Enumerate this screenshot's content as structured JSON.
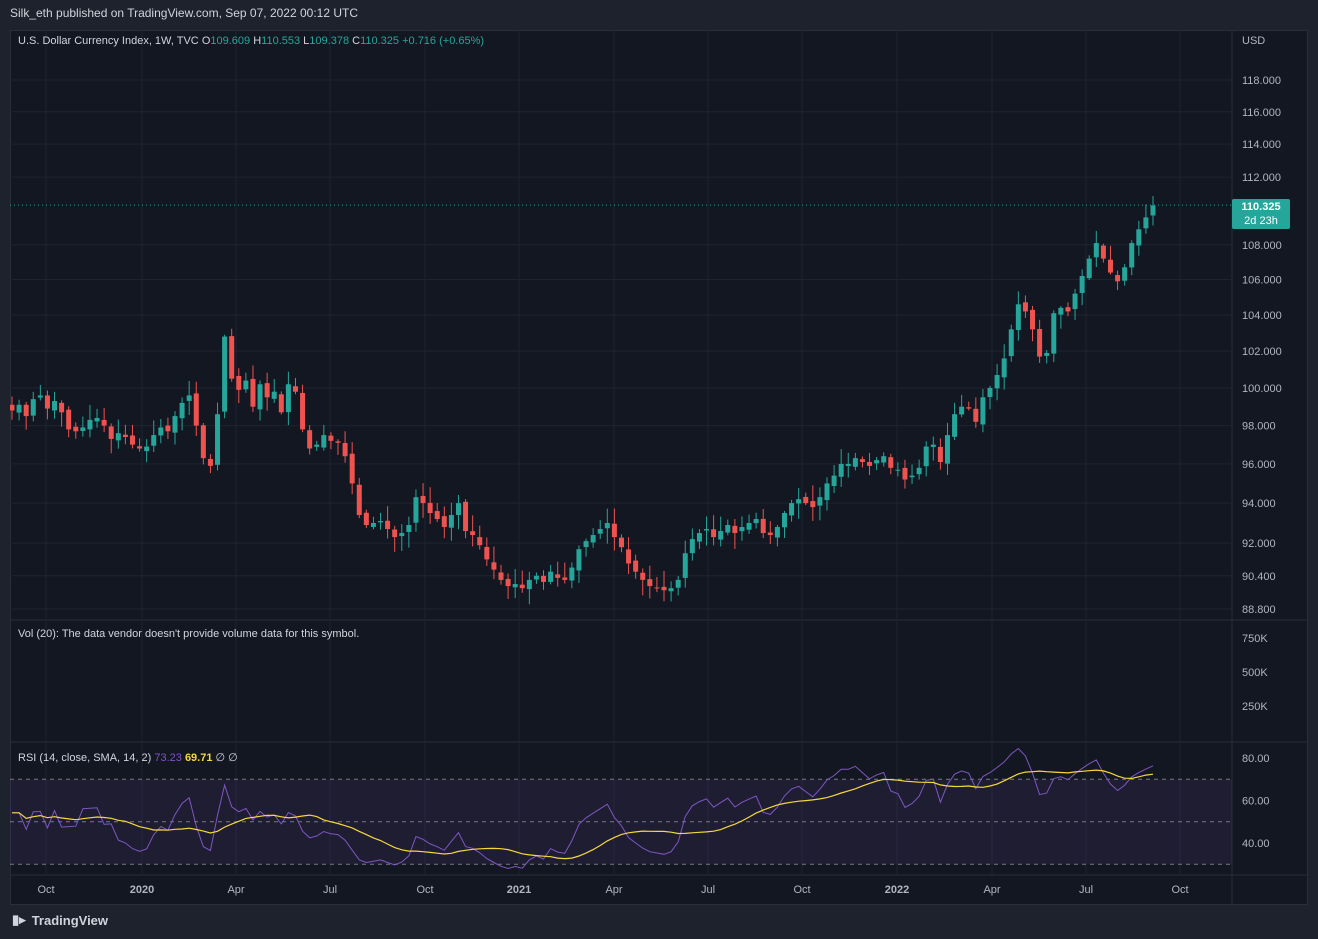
{
  "header": {
    "publisher_line": "Silk_eth published on TradingView.com, Sep 07, 2022 00:12 UTC"
  },
  "legend": {
    "symbol": "U.S. Dollar Currency Index, 1W, TVC",
    "o_label": "O",
    "o": "109.609",
    "h_label": "H",
    "h": "110.553",
    "l_label": "L",
    "l": "109.378",
    "c_label": "C",
    "c": "110.325",
    "change": "+0.716 (+0.65%)"
  },
  "price_axis": {
    "currency": "USD",
    "ticks": [
      "118.000",
      "116.000",
      "114.000",
      "112.000",
      "108.000",
      "106.000",
      "104.000",
      "102.000",
      "100.000",
      "98.000",
      "96.000",
      "94.000",
      "92.000",
      "90.400",
      "88.800"
    ],
    "last_price": "110.325",
    "countdown": "2d 23h"
  },
  "volume": {
    "legend": "Vol (20): The data vendor doesn't provide volume data for this symbol.",
    "ticks": [
      "750K",
      "500K",
      "250K"
    ]
  },
  "rsi": {
    "legend_label": "RSI (14, close, SMA, 14, 2)",
    "rsi_value": "73.23",
    "sma_value": "69.71",
    "extra": "∅ ∅",
    "ticks": [
      "80.00",
      "60.00",
      "40.00"
    ]
  },
  "time_axis": {
    "labels": [
      "Oct",
      "2020",
      "Apr",
      "Jul",
      "Oct",
      "2021",
      "Apr",
      "Jul",
      "Oct",
      "2022",
      "Apr",
      "Jul",
      "Oct"
    ]
  },
  "footer": {
    "brand": "TradingView"
  },
  "colors": {
    "up": "#26a69a",
    "down": "#ef5350",
    "rsi": "#7e57c2",
    "rsi_sma": "#f7d83b",
    "background": "#131722"
  },
  "chart_data": {
    "type": "candlestick",
    "title": "U.S. Dollar Currency Index, 1W, TVC",
    "ylim": [
      88.2,
      119.2
    ],
    "candles_weekly_close": [
      98.8,
      99.1,
      98.5,
      99.4,
      99.6,
      98.9,
      99.3,
      98.7,
      97.8,
      97.7,
      97.9,
      98.3,
      98.4,
      98.0,
      97.3,
      97.6,
      97.4,
      97.0,
      96.8,
      96.9,
      97.5,
      97.9,
      97.7,
      98.5,
      99.2,
      99.6,
      98.0,
      96.3,
      95.9,
      98.6,
      102.8,
      100.5,
      99.9,
      100.4,
      99.0,
      100.2,
      99.5,
      99.8,
      98.7,
      100.2,
      99.8,
      97.8,
      96.8,
      97.0,
      97.5,
      97.2,
      97.1,
      96.4,
      95.0,
      93.4,
      92.9,
      93.0,
      93.1,
      92.7,
      92.3,
      92.5,
      92.9,
      94.3,
      94.0,
      93.5,
      93.2,
      92.8,
      93.4,
      94.0,
      92.6,
      92.4,
      91.9,
      91.2,
      90.7,
      90.2,
      89.9,
      90.0,
      89.8,
      90.2,
      90.4,
      90.1,
      90.6,
      90.3,
      90.2,
      90.8,
      91.7,
      92.1,
      92.4,
      92.7,
      93.0,
      92.3,
      91.8,
      91.0,
      90.6,
      90.2,
      89.9,
      89.8,
      89.7,
      89.8,
      90.2,
      91.5,
      92.2,
      92.5,
      92.7,
      92.3,
      92.6,
      92.9,
      92.5,
      92.8,
      93.0,
      93.2,
      92.5,
      92.4,
      92.8,
      93.5,
      94.0,
      94.2,
      94.0,
      93.8,
      94.3,
      95.0,
      95.4,
      96.0,
      96.0,
      96.3,
      96.1,
      95.9,
      96.2,
      96.4,
      95.8,
      95.7,
      95.2,
      95.4,
      95.8,
      96.9,
      97.0,
      96.1,
      97.5,
      98.6,
      99.0,
      98.9,
      98.2,
      99.5,
      100.0,
      100.7,
      101.6,
      103.2,
      104.6,
      104.2,
      103.2,
      101.7,
      101.9,
      104.1,
      104.4,
      104.2,
      105.2,
      106.2,
      107.2,
      108.1,
      107.2,
      106.4,
      105.9,
      106.7,
      108.1,
      108.9,
      109.6,
      110.3
    ]
  }
}
